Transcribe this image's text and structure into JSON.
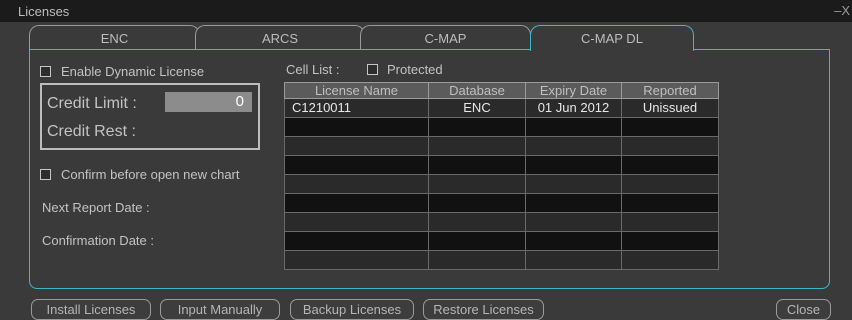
{
  "window": {
    "title": "Licenses",
    "close_glyph": "–X"
  },
  "tabs": [
    {
      "label": "ENC",
      "active": false
    },
    {
      "label": "ARCS",
      "active": false
    },
    {
      "label": "C-MAP",
      "active": false
    },
    {
      "label": "C-MAP DL",
      "active": true
    }
  ],
  "options": {
    "enable_dynamic_license": {
      "label": "Enable Dynamic License",
      "checked": false
    },
    "credit_limit_label": "Credit Limit :",
    "credit_limit_value": "0",
    "credit_rest_label": "Credit Rest :",
    "confirm_before_open": {
      "label": "Confirm before open new chart",
      "checked": false
    },
    "next_report_date_label": "Next Report Date :",
    "confirmation_date_label": "Confirmation Date :"
  },
  "cell_list": {
    "label": "Cell List :",
    "protected": {
      "label": "Protected",
      "checked": false
    },
    "columns": [
      "License Name",
      "Database",
      "Expiry Date",
      "Reported"
    ],
    "rows": [
      [
        "C1210011",
        "ENC",
        "01 Jun 2012",
        "Unissued"
      ],
      [
        "",
        "",
        "",
        ""
      ],
      [
        "",
        "",
        "",
        ""
      ],
      [
        "",
        "",
        "",
        ""
      ],
      [
        "",
        "",
        "",
        ""
      ],
      [
        "",
        "",
        "",
        ""
      ],
      [
        "",
        "",
        "",
        ""
      ],
      [
        "",
        "",
        "",
        ""
      ],
      [
        "",
        "",
        "",
        ""
      ]
    ]
  },
  "buttons": {
    "install": "Install Licenses",
    "input_manually": "Input Manually",
    "backup": "Backup Licenses",
    "restore": "Restore Licenses",
    "close": "Close"
  },
  "colors": {
    "accent": "#3eb7c9",
    "background": "#3a3a3a",
    "titlebar": "#1b1b1b",
    "credit_field": "#8c8c8c"
  }
}
